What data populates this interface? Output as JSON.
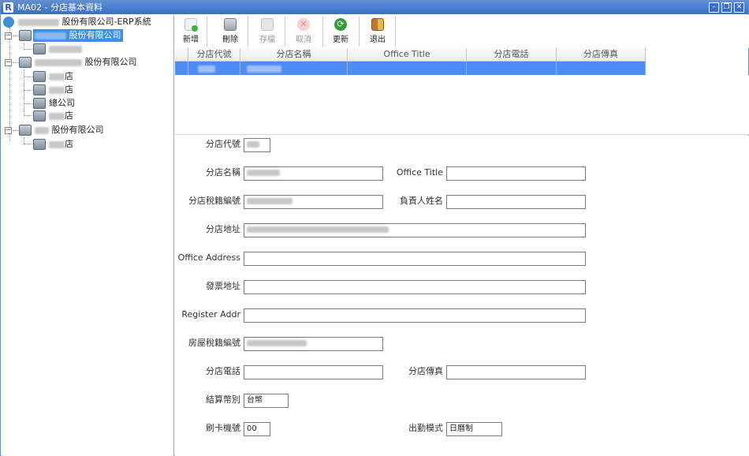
{
  "window": {
    "logo": "R",
    "title": "MA02 - 分店基本資料",
    "buttons": [
      "minimize",
      "restore",
      "close"
    ]
  },
  "tree": {
    "root_label": "股份有限公司-ERP系統",
    "companies": [
      {
        "label": "股份有限公司",
        "selected": true,
        "children": [
          {
            "label": ""
          }
        ]
      },
      {
        "label": "股份有限公司",
        "selected": false,
        "children": [
          {
            "label": "店"
          },
          {
            "label": "店"
          },
          {
            "label": "總公司"
          },
          {
            "label": "店"
          }
        ]
      },
      {
        "label": "股份有限公司",
        "selected": false,
        "children": [
          {
            "label": "店"
          }
        ]
      }
    ]
  },
  "toolbar": {
    "add": "新增",
    "delete": "刪除",
    "save": "存檔",
    "cancel": "取消",
    "update": "更新",
    "exit": "退出"
  },
  "grid": {
    "columns": [
      "分店代號",
      "分店名稱",
      "Office Title",
      "分店電話",
      "分店傳真"
    ]
  },
  "form": {
    "branch_code_label": "分店代號",
    "branch_name_label": "分店名稱",
    "office_title_label": "Office Title",
    "tax_id_label": "分店稅籍編號",
    "manager_label": "負責人姓名",
    "address_label": "分店地址",
    "office_address_label": "Office Address",
    "invoice_address_label": "發票地址",
    "register_addr_label": "Register Addr",
    "house_tax_label": "房屋稅籍編號",
    "phone_label": "分店電話",
    "fax_label": "分店傳真",
    "currency_label": "結算幣別",
    "currency_value": "台幣",
    "card_machine_label": "刷卡機號",
    "card_machine_value": "00",
    "attendance_label": "出勤模式",
    "attendance_value": "日曆制"
  },
  "colors": {
    "title_bar": "#3a6fc2",
    "selection": "#4b8df0"
  }
}
